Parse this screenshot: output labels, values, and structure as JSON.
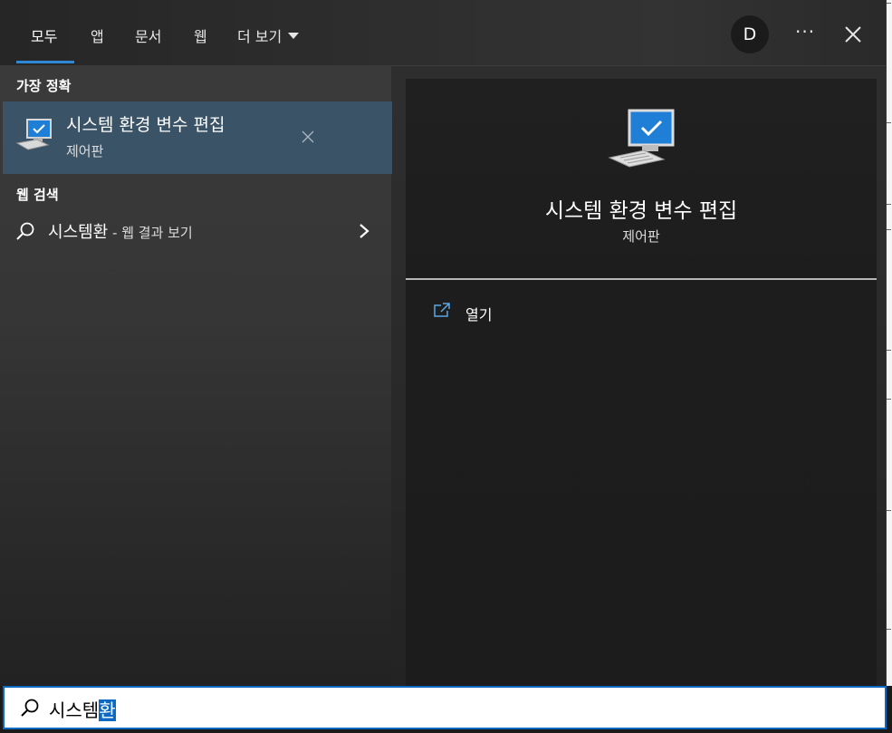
{
  "tabs": [
    {
      "label": "모두",
      "active": true
    },
    {
      "label": "앱"
    },
    {
      "label": "문서"
    },
    {
      "label": "웹"
    },
    {
      "label": "더 보기"
    }
  ],
  "account": {
    "initial": "D"
  },
  "more_label": "···",
  "best_match": {
    "section_label": "가장 정확",
    "title": "시스템 환경 변수 편집",
    "subtitle": "제어판"
  },
  "web_search": {
    "section_label": "웹 검색",
    "query": "시스템환",
    "suffix": " - 웹 결과 보기"
  },
  "preview": {
    "title": "시스템 환경 변수 편집",
    "subtitle": "제어판",
    "actions": [
      {
        "label": "열기",
        "icon": "open-external-icon"
      }
    ]
  },
  "search": {
    "typed_text": "시스템",
    "selected_text": "환"
  },
  "colors": {
    "accent": "#0a69c2",
    "selected_row": "#3b5366",
    "tab_underline": "#2e88d8"
  }
}
